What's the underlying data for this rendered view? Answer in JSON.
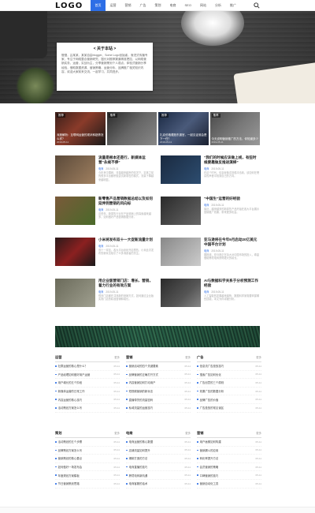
{
  "header": {
    "logo": "LOGO",
    "nav": [
      "首页",
      "运营",
      "营销",
      "广告",
      "策划",
      "电商",
      "SEO",
      "网站",
      "分析",
      "推广"
    ]
  },
  "hero": {
    "about_title": "< 关于本站 >",
    "about_text": "慢慢，吕某某，某某自由blogger、Some Logo创始者，渐进式传播专家，专注于网络整合营销研究，擅长对推荐渠道精准把控，以网络营销实务、运营，实战为主，分享营销策划个人观点，体验式营销分享经验，借助数据资源、营销策略、运营分析、品牌推广相关知识内容，欢迎大家前来交流，一起学习，共同进步。"
  },
  "features": [
    {
      "tag": "推荐",
      "title": "深度解析：互联网运营的现状和趋势怎么样？",
      "date": "2019-05-11"
    },
    {
      "tag": "推荐",
      "title": "",
      "date": ""
    },
    {
      "tag": "推荐",
      "title": "扎克伯格遭股东逼宫，一起见证谁会是下一任？",
      "date": "2019-05-11"
    },
    {
      "tag": "推荐",
      "title": "今天说明营销推广的方法，你知道多少",
      "date": "2019-05-11"
    }
  ],
  "articles": [
    {
      "title": "流量是根本还是行，新媒体运营“永续不停”",
      "cat": "电商",
      "date": "2019-05-11",
      "desc": "今年来中国网，流量越来越贵的情况下，实体之前的很多平台都积极尝试新零售的模式，流量下降越来越明显。"
    },
    {
      "title": "“我们的时候应该做上线，有些时候要靠做反推进演绎”",
      "cat": "电商",
      "date": "2019-05-11",
      "desc": "在这个时代，信息就像洪流般冲击着，该如何在嘈杂的声音中找到自己的方向。"
    },
    {
      "title": "新零售产品营销数据总结以及如何延伸到营销的风向标",
      "cat": "电商",
      "date": "2019-05-11",
      "desc": "这些年，新零售行业在产品营销上的探索越来越多，如何做好产品营销数据分析。"
    },
    {
      "title": "“中国生”运营的好经验",
      "cat": "电商",
      "date": "2019-05-11",
      "desc": "最近，越来越多的新零售产品开始在各大平台展示营销推广效果，带来更多机会。"
    },
    {
      "title": "小米将发布双十一大促新流量计划",
      "cat": "电商",
      "date": "2019-05-11",
      "desc": "双十一将至，各大平台纷纷开启预热，小米此次发布的新玩法吸引了众多消费者的关注。"
    },
    {
      "title": "亚马逊将在今年9月启动20亿美元中国平台计划",
      "cat": "电商",
      "date": "2019-05-11",
      "desc": "据报道，亚马逊正在加大对中国市场的投入，希望借助跨境电商获得更大的增长。"
    },
    {
      "title": "用企业版营销门店：增长、营销，着力行业的有效方案",
      "cat": "电商",
      "date": "2019-05-11",
      "desc": "很多门店都在寻找新的营销方式，如何通过企业版实现门店的精准营销和增长。"
    },
    {
      "title": "AI与数据科学关系于分析预测工作经验",
      "cat": "电商",
      "date": "2019-05-11",
      "desc": "人工智能的发展越来越快，数据科学家需要掌握哪些技能，本文为你详细分析。"
    }
  ],
  "columns_top": [
    {
      "name": "运营",
      "more": "更多",
      "items": [
        "社群运营的核心是什么？",
        "产品经理如何做好用户运营",
        "用户增长的五个阶段",
        "新媒体运营的日常工作",
        "内容运营的核心技巧",
        "活动策划方案怎么写"
      ]
    },
    {
      "name": "营销",
      "more": "更多",
      "items": [
        "营销活动的四个关键要素",
        "品牌营销的正确打开方式",
        "内容营销如何打动用户",
        "短视频营销的新玩法",
        "直播带货的流量密码",
        "私域流量的运营技巧"
      ]
    },
    {
      "name": "广告",
      "more": "更多",
      "items": [
        "信息流广告投放技巧",
        "搜索广告如何优化",
        "广告创意的三个原则",
        "效果广告的数据分析",
        "品牌广告的价值",
        "广告投放的常见误区"
      ]
    }
  ],
  "columns_bottom": [
    {
      "name": "策划",
      "more": "更多",
      "items": [
        "活动策划的五个步骤",
        "品牌策划方案怎么写",
        "营销策划的核心要点",
        "如何做好一场发布会",
        "年度规划方案模板",
        "节日营销策划思路"
      ]
    },
    {
      "name": "电商",
      "more": "更多",
      "items": [
        "电商运营的核心数据",
        "店铺流量如何提升",
        "爆款打造的方法",
        "电商直播的技巧",
        "跨境电商新机遇",
        "电商客服的话术"
      ]
    },
    {
      "name": "营销",
      "more": "更多",
      "items": [
        "用户画像如何构建",
        "营销漏斗的应用",
        "转化率提升方法",
        "会员营销的策略",
        "口碑营销的技巧",
        "营销自动化工具"
      ]
    }
  ],
  "item_date": "05-11"
}
